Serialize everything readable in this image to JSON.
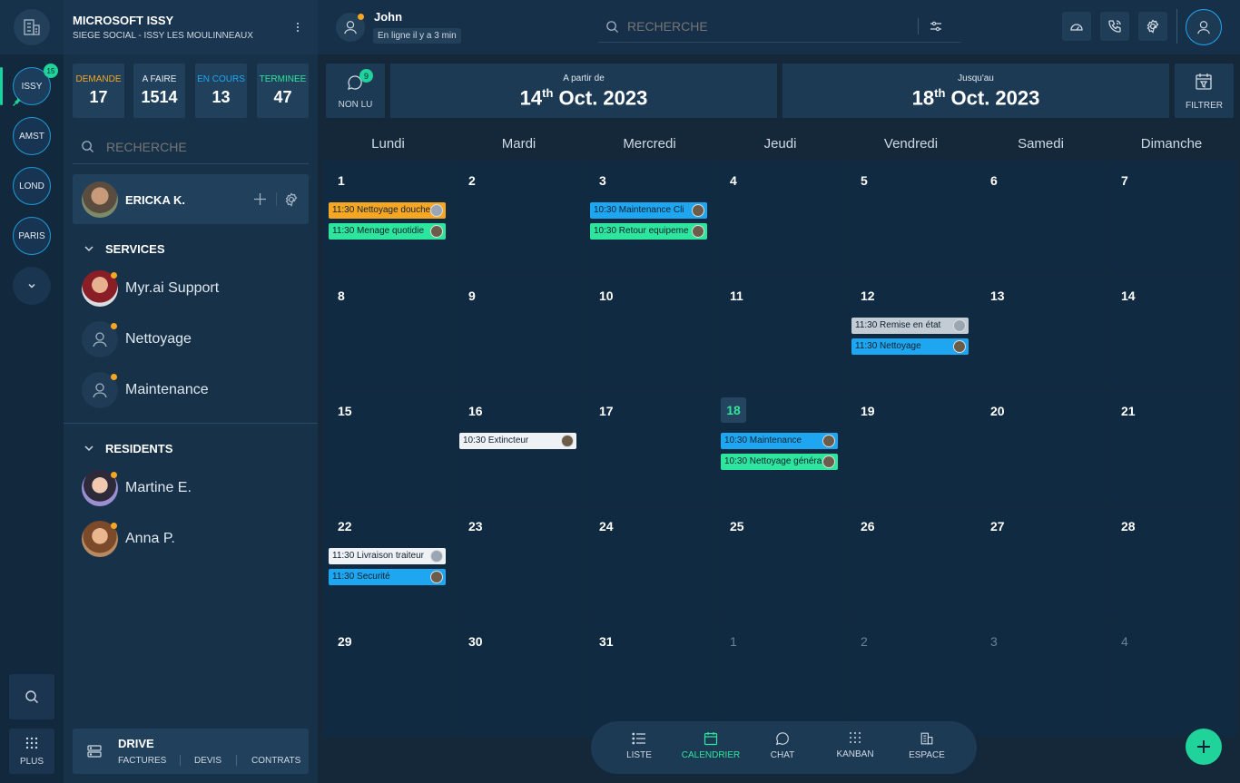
{
  "org": {
    "name": "MICROSOFT ISSY",
    "subtitle": "SIEGE SOCIAL - ISSY LES MOULINNEAUX"
  },
  "rail": {
    "sites": [
      "ISSY",
      "AMST",
      "LOND",
      "PARIS"
    ],
    "issy_badge": "15",
    "plus_label": "PLUS"
  },
  "stats": [
    {
      "label": "DEMANDE",
      "value": "17",
      "color": "#f5a623"
    },
    {
      "label": "A FAIRE",
      "value": "1514",
      "color": "#e6edf3"
    },
    {
      "label": "EN COURS",
      "value": "13",
      "color": "#1ea7f0"
    },
    {
      "label": "TERMINEE",
      "value": "47",
      "color": "#2ee59d"
    }
  ],
  "sidebar": {
    "search_placeholder": "RECHERCHE",
    "current_user": "ERICKA K.",
    "services_title": "SERVICES",
    "services": [
      "Myr.ai Support",
      "Nettoyage",
      "Maintenance"
    ],
    "residents_title": "RESIDENTS",
    "residents": [
      "Martine E.",
      "Anna P."
    ]
  },
  "drive": {
    "title": "DRIVE",
    "links": [
      "FACTURES",
      "DEVIS",
      "CONTRATS"
    ]
  },
  "topbar": {
    "user": "John",
    "status": "En ligne il y a 3 min",
    "search_placeholder": "RECHERCHE"
  },
  "unread": {
    "count": "9",
    "label": "NON LU"
  },
  "range": {
    "from_label": "A partir de",
    "from_day": "14",
    "from_suffix": "th",
    "from_rest": "Oct. 2023",
    "to_label": "Jusqu'au",
    "to_day": "18",
    "to_suffix": "th",
    "to_rest": "Oct. 2023"
  },
  "filter_label": "FILTRER",
  "calendar": {
    "days": [
      "Lundi",
      "Mardi",
      "Mercredi",
      "Jeudi",
      "Vendredi",
      "Samedi",
      "Dimanche"
    ],
    "cells": [
      "1",
      "2",
      "3",
      "4",
      "5",
      "6",
      "7",
      "8",
      "9",
      "10",
      "11",
      "12",
      "13",
      "14",
      "15",
      "16",
      "17",
      "18",
      "19",
      "20",
      "21",
      "22",
      "23",
      "24",
      "25",
      "26",
      "27",
      "28",
      "29",
      "30",
      "31",
      "1",
      "2",
      "3",
      "4"
    ],
    "today_index": 17,
    "dim_from": 31,
    "events": [
      {
        "cell": 0,
        "slot": 0,
        "text": "11:30 Nettoyage douche",
        "color": "orange",
        "avatar": "grey"
      },
      {
        "cell": 0,
        "slot": 1,
        "text": "11:30 Menage quotidie",
        "color": "green",
        "avatar": "photo"
      },
      {
        "cell": 2,
        "slot": 0,
        "text": "10:30 Maintenance Cli",
        "color": "blue",
        "avatar": "photo"
      },
      {
        "cell": 2,
        "slot": 1,
        "text": "10:30 Retour equipeme",
        "color": "green",
        "avatar": "photo"
      },
      {
        "cell": 11,
        "slot": 0,
        "text": "11:30 Remise en état",
        "color": "grey",
        "avatar": "grey"
      },
      {
        "cell": 11,
        "slot": 1,
        "text": "11:30 Nettoyage",
        "color": "blue",
        "avatar": "photo"
      },
      {
        "cell": 15,
        "slot": 0,
        "text": "10:30 Extincteur",
        "color": "white",
        "avatar": "photo"
      },
      {
        "cell": 17,
        "slot": 0,
        "text": "10:30 Maintenance",
        "color": "blue",
        "avatar": "photo"
      },
      {
        "cell": 17,
        "slot": 1,
        "text": "10:30 Nettoyage généra",
        "color": "green",
        "avatar": "photo"
      },
      {
        "cell": 21,
        "slot": 0,
        "text": "11:30 Livraison traiteur",
        "color": "white",
        "avatar": "grey"
      },
      {
        "cell": 21,
        "slot": 1,
        "text": "11:30 Securité",
        "color": "blue",
        "avatar": "photo"
      }
    ]
  },
  "bottom_nav": [
    {
      "label": "LISTE",
      "icon": "list-icon"
    },
    {
      "label": "CALENDRIER",
      "icon": "calendar-icon"
    },
    {
      "label": "CHAT",
      "icon": "chat-icon"
    },
    {
      "label": "KANBAN",
      "icon": "kanban-icon"
    },
    {
      "label": "ESPACE",
      "icon": "building-icon"
    }
  ],
  "colors": {
    "accent": "#2ee59d",
    "orange": "#f5a623",
    "blue": "#1ea7f0"
  }
}
